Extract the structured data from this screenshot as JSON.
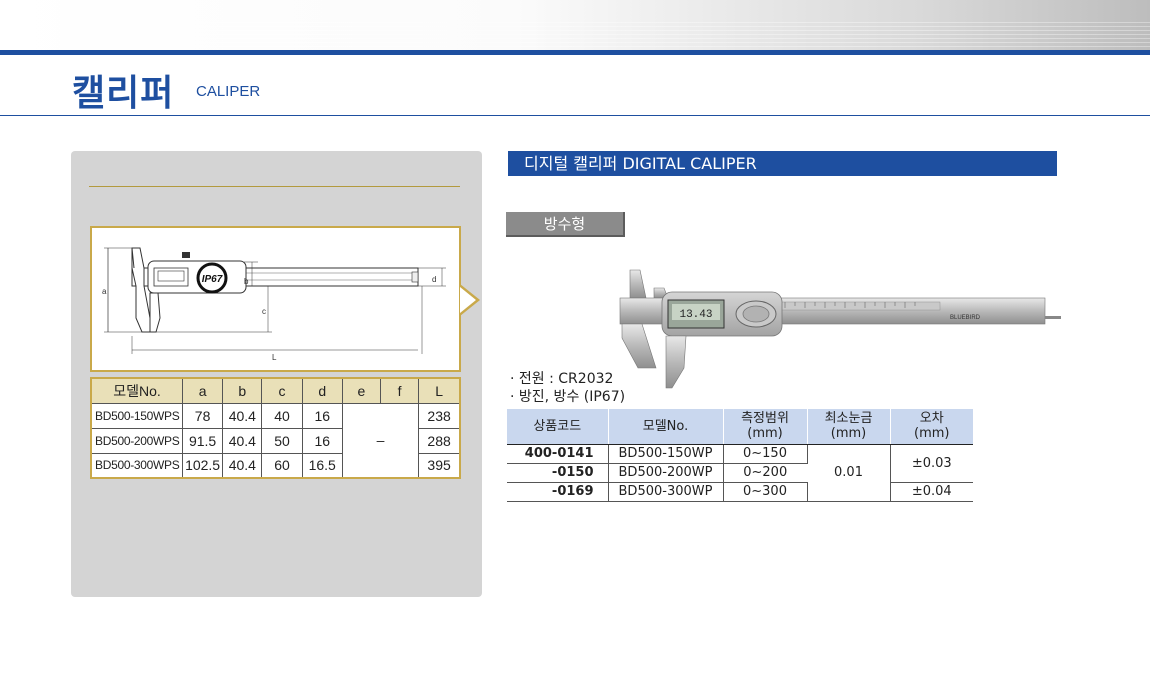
{
  "header": {
    "title_ko": "캘리퍼",
    "title_en": "CALIPER"
  },
  "diagram": {
    "dim_labels": [
      "a",
      "b",
      "c",
      "d",
      "L"
    ],
    "ip_badge": "IP67"
  },
  "dimension_table": {
    "columns": [
      "모델No.",
      "a",
      "b",
      "c",
      "d",
      "e",
      "f",
      "L"
    ],
    "rows": [
      {
        "model": "BD500-150WPS",
        "a": "78",
        "b": "40.4",
        "c": "40",
        "d": "16",
        "L": "238"
      },
      {
        "model": "BD500-200WPS",
        "a": "91.5",
        "b": "40.4",
        "c": "50",
        "d": "16",
        "L": "288"
      },
      {
        "model": "BD500-300WPS",
        "a": "102.5",
        "b": "40.4",
        "c": "60",
        "d": "16.5",
        "L": "395"
      }
    ],
    "ef_merged": "–"
  },
  "product": {
    "section_title": "디지털 캘리퍼 DIGITAL CALIPER",
    "type_tab": "방수형",
    "display_reading": "13.43",
    "brand": "BLUEBIRD",
    "specs": [
      "· 전원 : CR2032",
      "· 방진, 방수 (IP67)"
    ]
  },
  "code_table": {
    "headers": [
      "상품코드",
      "모델No.",
      "측정범위\n(mm)",
      "최소눈금\n(mm)",
      "오차\n(mm)"
    ],
    "header_lines": [
      [
        "상품코드"
      ],
      [
        "모델No."
      ],
      [
        "측정범위",
        "(mm)"
      ],
      [
        "최소눈금",
        "(mm)"
      ],
      [
        "오차",
        "(mm)"
      ]
    ],
    "rows": [
      {
        "code": "400-0141",
        "model": "BD500-150WP",
        "range": "0~150"
      },
      {
        "code": "-0150",
        "model": "BD500-200WP",
        "range": "0~200"
      },
      {
        "code": "-0169",
        "model": "BD500-300WP",
        "range": "0~300"
      }
    ],
    "resolution": "0.01",
    "error_1": "±0.03",
    "error_2": "±0.04"
  },
  "colors": {
    "brand_blue": "#1e4fa0",
    "gold": "#c9a94a",
    "panel_gray": "#d4d4d4",
    "table_header_blue": "#c9d7ee"
  }
}
